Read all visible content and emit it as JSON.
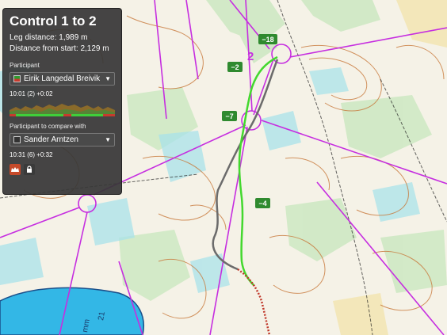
{
  "panel": {
    "title": "Control 1 to 2",
    "leg_distance": "Leg distance: 1,989 m",
    "distance_from_start": "Distance from start: 2,129 m",
    "participant_label": "Participant",
    "participant_name": "Eirik Langedal Breivik",
    "participant_time": "10:01 (2) +0:02",
    "compare_label": "Participant to compare with",
    "compare_name": "Sander Arntzen",
    "compare_time": "10:31 (6) +0:32",
    "compare_swatch_color": "#333333",
    "participant_swatch_colors": [
      "#2f9a2f",
      "#c63b2e"
    ],
    "icons": [
      "crown-icon",
      "lock-icon"
    ],
    "buttons_color": "#c64a2a"
  },
  "map": {
    "course_color": "#c62ee0",
    "route_main_color": "#43d82e",
    "route_compare_color": "#6b6b6b",
    "tail_color": "#c0392b",
    "control_number": "2",
    "time_labels": [
      "−18",
      "−2",
      "−7",
      "−4"
    ],
    "lake_text": [
      "mm",
      "21"
    ]
  }
}
